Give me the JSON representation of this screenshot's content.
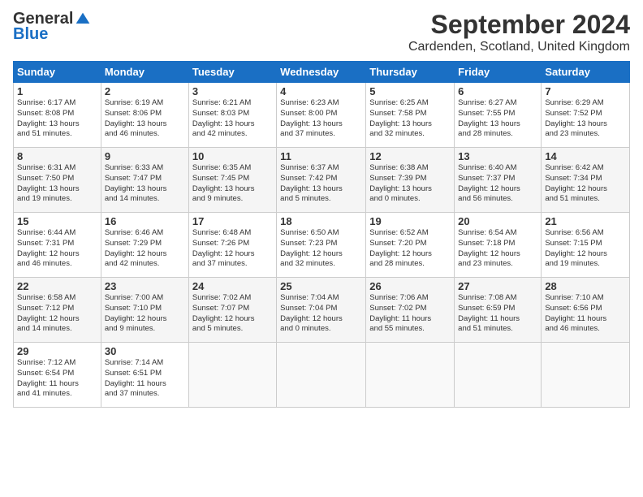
{
  "header": {
    "logo_general": "General",
    "logo_blue": "Blue",
    "month_title": "September 2024",
    "location": "Cardenden, Scotland, United Kingdom"
  },
  "columns": [
    "Sunday",
    "Monday",
    "Tuesday",
    "Wednesday",
    "Thursday",
    "Friday",
    "Saturday"
  ],
  "weeks": [
    [
      {
        "day": "1",
        "lines": [
          "Sunrise: 6:17 AM",
          "Sunset: 8:08 PM",
          "Daylight: 13 hours",
          "and 51 minutes."
        ]
      },
      {
        "day": "2",
        "lines": [
          "Sunrise: 6:19 AM",
          "Sunset: 8:06 PM",
          "Daylight: 13 hours",
          "and 46 minutes."
        ]
      },
      {
        "day": "3",
        "lines": [
          "Sunrise: 6:21 AM",
          "Sunset: 8:03 PM",
          "Daylight: 13 hours",
          "and 42 minutes."
        ]
      },
      {
        "day": "4",
        "lines": [
          "Sunrise: 6:23 AM",
          "Sunset: 8:00 PM",
          "Daylight: 13 hours",
          "and 37 minutes."
        ]
      },
      {
        "day": "5",
        "lines": [
          "Sunrise: 6:25 AM",
          "Sunset: 7:58 PM",
          "Daylight: 13 hours",
          "and 32 minutes."
        ]
      },
      {
        "day": "6",
        "lines": [
          "Sunrise: 6:27 AM",
          "Sunset: 7:55 PM",
          "Daylight: 13 hours",
          "and 28 minutes."
        ]
      },
      {
        "day": "7",
        "lines": [
          "Sunrise: 6:29 AM",
          "Sunset: 7:52 PM",
          "Daylight: 13 hours",
          "and 23 minutes."
        ]
      }
    ],
    [
      {
        "day": "8",
        "lines": [
          "Sunrise: 6:31 AM",
          "Sunset: 7:50 PM",
          "Daylight: 13 hours",
          "and 19 minutes."
        ]
      },
      {
        "day": "9",
        "lines": [
          "Sunrise: 6:33 AM",
          "Sunset: 7:47 PM",
          "Daylight: 13 hours",
          "and 14 minutes."
        ]
      },
      {
        "day": "10",
        "lines": [
          "Sunrise: 6:35 AM",
          "Sunset: 7:45 PM",
          "Daylight: 13 hours",
          "and 9 minutes."
        ]
      },
      {
        "day": "11",
        "lines": [
          "Sunrise: 6:37 AM",
          "Sunset: 7:42 PM",
          "Daylight: 13 hours",
          "and 5 minutes."
        ]
      },
      {
        "day": "12",
        "lines": [
          "Sunrise: 6:38 AM",
          "Sunset: 7:39 PM",
          "Daylight: 13 hours",
          "and 0 minutes."
        ]
      },
      {
        "day": "13",
        "lines": [
          "Sunrise: 6:40 AM",
          "Sunset: 7:37 PM",
          "Daylight: 12 hours",
          "and 56 minutes."
        ]
      },
      {
        "day": "14",
        "lines": [
          "Sunrise: 6:42 AM",
          "Sunset: 7:34 PM",
          "Daylight: 12 hours",
          "and 51 minutes."
        ]
      }
    ],
    [
      {
        "day": "15",
        "lines": [
          "Sunrise: 6:44 AM",
          "Sunset: 7:31 PM",
          "Daylight: 12 hours",
          "and 46 minutes."
        ]
      },
      {
        "day": "16",
        "lines": [
          "Sunrise: 6:46 AM",
          "Sunset: 7:29 PM",
          "Daylight: 12 hours",
          "and 42 minutes."
        ]
      },
      {
        "day": "17",
        "lines": [
          "Sunrise: 6:48 AM",
          "Sunset: 7:26 PM",
          "Daylight: 12 hours",
          "and 37 minutes."
        ]
      },
      {
        "day": "18",
        "lines": [
          "Sunrise: 6:50 AM",
          "Sunset: 7:23 PM",
          "Daylight: 12 hours",
          "and 32 minutes."
        ]
      },
      {
        "day": "19",
        "lines": [
          "Sunrise: 6:52 AM",
          "Sunset: 7:20 PM",
          "Daylight: 12 hours",
          "and 28 minutes."
        ]
      },
      {
        "day": "20",
        "lines": [
          "Sunrise: 6:54 AM",
          "Sunset: 7:18 PM",
          "Daylight: 12 hours",
          "and 23 minutes."
        ]
      },
      {
        "day": "21",
        "lines": [
          "Sunrise: 6:56 AM",
          "Sunset: 7:15 PM",
          "Daylight: 12 hours",
          "and 19 minutes."
        ]
      }
    ],
    [
      {
        "day": "22",
        "lines": [
          "Sunrise: 6:58 AM",
          "Sunset: 7:12 PM",
          "Daylight: 12 hours",
          "and 14 minutes."
        ]
      },
      {
        "day": "23",
        "lines": [
          "Sunrise: 7:00 AM",
          "Sunset: 7:10 PM",
          "Daylight: 12 hours",
          "and 9 minutes."
        ]
      },
      {
        "day": "24",
        "lines": [
          "Sunrise: 7:02 AM",
          "Sunset: 7:07 PM",
          "Daylight: 12 hours",
          "and 5 minutes."
        ]
      },
      {
        "day": "25",
        "lines": [
          "Sunrise: 7:04 AM",
          "Sunset: 7:04 PM",
          "Daylight: 12 hours",
          "and 0 minutes."
        ]
      },
      {
        "day": "26",
        "lines": [
          "Sunrise: 7:06 AM",
          "Sunset: 7:02 PM",
          "Daylight: 11 hours",
          "and 55 minutes."
        ]
      },
      {
        "day": "27",
        "lines": [
          "Sunrise: 7:08 AM",
          "Sunset: 6:59 PM",
          "Daylight: 11 hours",
          "and 51 minutes."
        ]
      },
      {
        "day": "28",
        "lines": [
          "Sunrise: 7:10 AM",
          "Sunset: 6:56 PM",
          "Daylight: 11 hours",
          "and 46 minutes."
        ]
      }
    ],
    [
      {
        "day": "29",
        "lines": [
          "Sunrise: 7:12 AM",
          "Sunset: 6:54 PM",
          "Daylight: 11 hours",
          "and 41 minutes."
        ]
      },
      {
        "day": "30",
        "lines": [
          "Sunrise: 7:14 AM",
          "Sunset: 6:51 PM",
          "Daylight: 11 hours",
          "and 37 minutes."
        ]
      },
      {
        "day": "",
        "lines": []
      },
      {
        "day": "",
        "lines": []
      },
      {
        "day": "",
        "lines": []
      },
      {
        "day": "",
        "lines": []
      },
      {
        "day": "",
        "lines": []
      }
    ]
  ]
}
